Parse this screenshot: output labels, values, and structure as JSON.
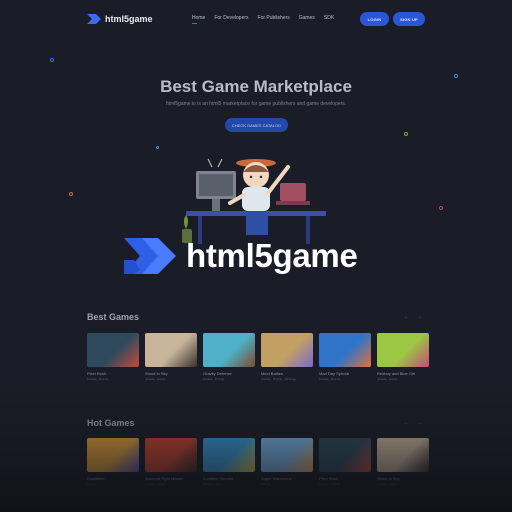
{
  "header": {
    "logo_text": "html5game",
    "nav": [
      {
        "label": "Home",
        "active": true
      },
      {
        "label": "For Developers",
        "active": false
      },
      {
        "label": "For Publishers",
        "active": false
      },
      {
        "label": "Games",
        "active": false
      },
      {
        "label": "SDK",
        "active": false
      }
    ],
    "login_label": "LOGIN",
    "signup_label": "SIGN UP"
  },
  "hero": {
    "title": "Best Game Marketplace",
    "subtitle": "html5game.io is an html5 marketplace for game publishers and game developers.",
    "cta_label": "CHECK GAMES CATALOG"
  },
  "overlay": {
    "brand_text": "html5game"
  },
  "best_games": {
    "title": "Best Games",
    "prev": "←",
    "next": "→",
    "items": [
      {
        "title": "Pixel Rush",
        "meta": "Arcade · Puzzle",
        "color1": "#2e4a5c",
        "color2": "#c24a3a"
      },
      {
        "title": "Shoot in Sky",
        "meta": "Arcade · Action",
        "color1": "#c7b49a",
        "color2": "#3a2f2c"
      },
      {
        "title": "Gravity Defense",
        "meta": "Arcade · Puzzle",
        "color1": "#4fb1c9",
        "color2": "#7a4b2e"
      },
      {
        "title": "Mind Battles",
        "meta": "Arcade · Puzzle · Strategy",
        "color1": "#c2a063",
        "color2": "#7a6ad0"
      },
      {
        "title": "Mad Day Special",
        "meta": "Arcade · Puzzle",
        "color1": "#2f74c9",
        "color2": "#e56f3b"
      },
      {
        "title": "Redboy and Blue Girl",
        "meta": "Arcade · Action",
        "color1": "#9bc743",
        "color2": "#c74a7a"
      }
    ]
  },
  "hot_games": {
    "title": "Hot Games",
    "prev": "←",
    "next": "→",
    "items": [
      {
        "title": "Sushitime",
        "meta": "Arcade",
        "color1": "#e0a03a",
        "color2": "#5b4fa8"
      },
      {
        "title": "Samurai Fight Master",
        "meta": "Arcade · Action",
        "color1": "#c6442f",
        "color2": "#3a2a2a"
      },
      {
        "title": "Zombies Shooter",
        "meta": "Arcade · Action",
        "color1": "#3a9ad6",
        "color2": "#d6c33a"
      },
      {
        "title": "Super Marmoons",
        "meta": "Arcade",
        "color1": "#7ab6e8",
        "color2": "#e8a34a"
      },
      {
        "title": "Pixel Rush",
        "meta": "Arcade · Puzzle",
        "color1": "#2e4a5c",
        "color2": "#c24a3a"
      },
      {
        "title": "Shoot in Sky",
        "meta": "Arcade · Action",
        "color1": "#c7b49a",
        "color2": "#3a2f2c"
      }
    ]
  },
  "colors": {
    "background": "#1a1d27",
    "accent": "#2a57d6",
    "brand_blue": "#3a6cf0"
  }
}
